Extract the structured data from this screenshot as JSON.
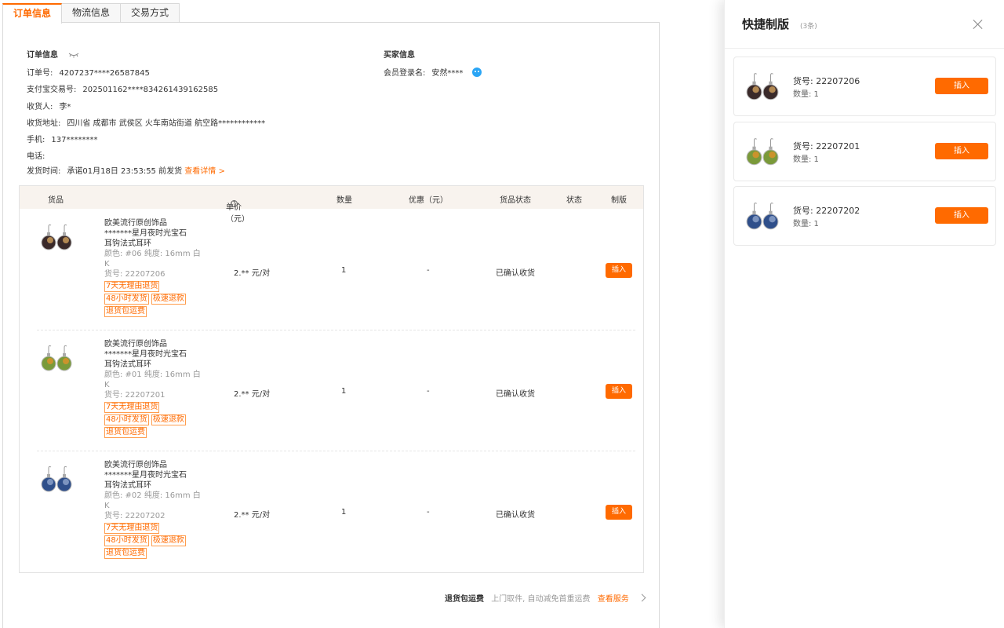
{
  "tabs": [
    {
      "label": "订单信息",
      "active": true
    },
    {
      "label": "物流信息",
      "active": false
    },
    {
      "label": "交易方式",
      "active": false
    }
  ],
  "order": {
    "title": "订单信息",
    "fields": [
      {
        "label": "订单号:",
        "value": "4207237****26587845"
      },
      {
        "label": "支付宝交易号:",
        "value": "202501162****834261439162585"
      },
      {
        "label": "收货人:",
        "value": "李*"
      },
      {
        "label": "收货地址:",
        "value": "四川省 成都市 武侯区 火车南站街道 航空路************"
      },
      {
        "label": "手机:",
        "value": "137********"
      },
      {
        "label": "电话:",
        "value": ""
      }
    ],
    "ship_label": "发货时间:",
    "ship_value": "承诺01月18日 23:53:55 前发货",
    "ship_link": "查看详情 >"
  },
  "buyer": {
    "title": "买家信息",
    "login_label": "会员登录名:",
    "login_value": "安然****"
  },
  "table": {
    "headers": {
      "goods": "货品",
      "price": "单价（元）",
      "qty": "数量",
      "discount": "优惠（元）",
      "goods_status": "货品状态",
      "status": "状态",
      "plate": "制版"
    },
    "rows": [
      {
        "name1": "欧美流行原创饰品",
        "name2": "*******星月夜时光宝石",
        "name3": "耳钩法式耳环",
        "spec": "颜色: #06 纯度: 16mm 白K",
        "sku": "货号: 22207206",
        "tags": [
          "7天无理由退货",
          "48小时发货",
          "极速退款",
          "退货包运费"
        ],
        "price": "2.** 元/对",
        "qty": "1",
        "discount": "-",
        "goods_status": "已确认收货",
        "btn": "插入",
        "colors": [
          "#3a2a2a",
          "#c89a5a"
        ]
      },
      {
        "name1": "欧美流行原创饰品",
        "name2": "*******星月夜时光宝石",
        "name3": "耳钩法式耳环",
        "spec": "颜色: #01 纯度: 16mm 白K",
        "sku": "货号: 22207201",
        "tags": [
          "7天无理由退货",
          "48小时发货",
          "极速退款",
          "退货包运费"
        ],
        "price": "2.** 元/对",
        "qty": "1",
        "discount": "-",
        "goods_status": "已确认收货",
        "btn": "插入",
        "colors": [
          "#7a9a3a",
          "#d9922a"
        ]
      },
      {
        "name1": "欧美流行原创饰品",
        "name2": "*******星月夜时光宝石",
        "name3": "耳钩法式耳环",
        "spec": "颜色: #02 纯度: 16mm 白K",
        "sku": "货号: 22207202",
        "tags": [
          "7天无理由退货",
          "48小时发货",
          "极速退款",
          "退货包运费"
        ],
        "price": "2.** 元/对",
        "qty": "1",
        "discount": "-",
        "goods_status": "已确认收货",
        "btn": "插入",
        "colors": [
          "#2f4f8a",
          "#8aa0c8"
        ]
      }
    ]
  },
  "service": {
    "bold": "退货包运费",
    "desc": "上门取件, 自动减免首重运费",
    "link": "查看服务"
  },
  "drawer": {
    "title": "快捷制版",
    "count": "(3条)",
    "cards": [
      {
        "sku": "货号: 22207206",
        "qty": "数量: 1",
        "btn": "插入",
        "colors": [
          "#3a2a2a",
          "#c89a5a"
        ]
      },
      {
        "sku": "货号: 22207201",
        "qty": "数量: 1",
        "btn": "插入",
        "colors": [
          "#7a9a3a",
          "#d9922a"
        ]
      },
      {
        "sku": "货号: 22207202",
        "qty": "数量: 1",
        "btn": "插入",
        "colors": [
          "#2f4f8a",
          "#8aa0c8"
        ]
      }
    ]
  },
  "colors": {
    "accent": "#ff6a00",
    "header_bg": "#f8f3ee"
  }
}
